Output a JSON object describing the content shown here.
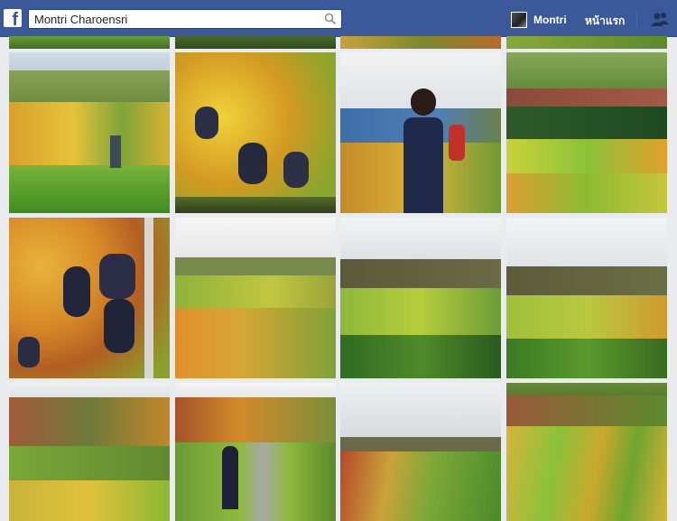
{
  "header": {
    "search_value": "Montri Charoensri",
    "profile_name": "Montri",
    "home_label": "หน้าแรก"
  },
  "photos": [
    "vineyard-row",
    "grapes-closeup",
    "woman-vineyard",
    "colorful-fields",
    "grapes-hanging",
    "valley-view",
    "rolling-hills",
    "hills-panorama",
    "forest-hills",
    "woman-path",
    "distant-valley",
    "field-rows"
  ]
}
